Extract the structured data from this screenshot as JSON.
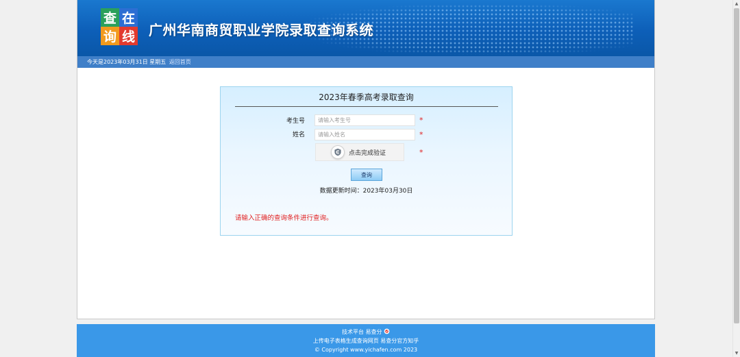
{
  "header": {
    "logo_chars": [
      "查",
      "在",
      "询",
      "线"
    ],
    "site_title": "广州华南商贸职业学院录取查询系统"
  },
  "date_bar": {
    "date_text": "今天是2023年03月31日  星期五",
    "home_link": "返回首页"
  },
  "query_panel": {
    "title": "2023年春季高考录取查询",
    "fields": [
      {
        "label": "考生号",
        "placeholder": "请输入考生号"
      },
      {
        "label": "姓名",
        "placeholder": "请输入姓名"
      }
    ],
    "required_mark": "*",
    "captcha_text": "点击完成验证",
    "submit_label": "查询",
    "update_time": "数据更新时间：2023年03月30日",
    "warning": "请输入正确的查询条件进行查询。"
  },
  "footer": {
    "line1": "技术平台 易查分",
    "line2": "上传电子表格生成查询网页 易查分官方知乎",
    "line3": "© Copyright www.yichafen.com 2023"
  },
  "colors": {
    "banner_blue": "#0d5fb8",
    "panel_border": "#9cd4ef",
    "warning_red": "#e02020",
    "footer_blue": "#3a98e8"
  }
}
